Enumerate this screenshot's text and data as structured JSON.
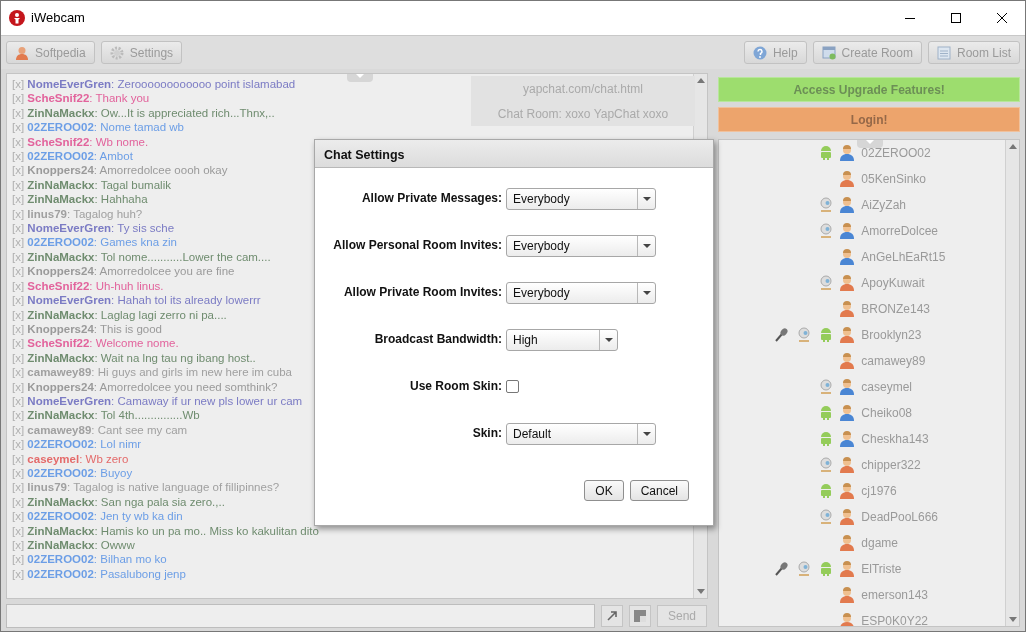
{
  "window": {
    "title": "iWebcam"
  },
  "toolbar": {
    "left": [
      {
        "label": "Softpedia"
      },
      {
        "label": "Settings"
      }
    ],
    "right": [
      {
        "label": "Help"
      },
      {
        "label": "Create Room"
      },
      {
        "label": "Room List"
      }
    ]
  },
  "chat": {
    "messages": [
      {
        "mark": "[x]",
        "name": "NomeEverGren",
        "text": ": Zeroooooooooooo point islamabad",
        "color": "#7b7bc4"
      },
      {
        "mark": "[x]",
        "name": "ScheSnif22",
        "text": ": Thank you",
        "color": "#e2639c"
      },
      {
        "mark": "[x]",
        "name": "ZinNaMackx",
        "text": ": Ow...It is appreciated rich...Thnx,..",
        "color": "#6f8c6f"
      },
      {
        "mark": "[x]",
        "name": "02ZEROO02",
        "text": ": Nome tamad wb",
        "color": "#6c9ee6"
      },
      {
        "mark": "[x]",
        "name": "ScheSnif22",
        "text": ": Wb nome.",
        "color": "#e2639c"
      },
      {
        "mark": "[x]",
        "name": "02ZEROO02",
        "text": ": Ambot",
        "color": "#6c9ee6"
      },
      {
        "mark": "[x]",
        "name": "Knoppers24",
        "text": ": Amorredolcee oooh okay",
        "color": "#9a9a9a"
      },
      {
        "mark": "[x]",
        "name": "ZinNaMackx",
        "text": ": Tagal bumalik",
        "color": "#6f8c6f"
      },
      {
        "mark": "[x]",
        "name": "ZinNaMackx",
        "text": ": Hahhaha",
        "color": "#6f8c6f"
      },
      {
        "mark": "[x]",
        "name": "linus79",
        "text": ": Tagalog huh?",
        "color": "#a0a0a0"
      },
      {
        "mark": "[x]",
        "name": "NomeEverGren",
        "text": ": Ty sis sche",
        "color": "#7b7bc4"
      },
      {
        "mark": "[x]",
        "name": "02ZEROO02",
        "text": ": Games kna zin",
        "color": "#6c9ee6"
      },
      {
        "mark": "[x]",
        "name": "ZinNaMackx",
        "text": ": Tol nome...........Lower the cam....",
        "color": "#6f8c6f"
      },
      {
        "mark": "[x]",
        "name": "Knoppers24",
        "text": ": Amorredolcee you are fine",
        "color": "#9a9a9a"
      },
      {
        "mark": "[x]",
        "name": "ScheSnif22",
        "text": ": Uh-huh linus.",
        "color": "#e2639c"
      },
      {
        "mark": "[x]",
        "name": "NomeEverGren",
        "text": ": Hahah tol its already lowerrr",
        "color": "#7b7bc4"
      },
      {
        "mark": "[x]",
        "name": "ZinNaMackx",
        "text": ": Laglag lagi zerro ni pa....",
        "color": "#6f8c6f"
      },
      {
        "mark": "[x]",
        "name": "Knoppers24",
        "text": ": This is good",
        "color": "#9a9a9a"
      },
      {
        "mark": "[x]",
        "name": "ScheSnif22",
        "text": ": Welcome nome.",
        "color": "#e2639c"
      },
      {
        "mark": "[x]",
        "name": "ZinNaMackx",
        "text": ": Wait na lng tau ng ibang host..",
        "color": "#6f8c6f"
      },
      {
        "mark": "[x]",
        "name": "camawey89",
        "text": ": Hi guys and girls im new here im cuba",
        "color": "#a0a0a0"
      },
      {
        "mark": "[x]",
        "name": "Knoppers24",
        "text": ": Amorredolcee you need somthink?",
        "color": "#9a9a9a"
      },
      {
        "mark": "[x]",
        "name": "NomeEverGren",
        "text": ": Camaway if ur new pls lower ur cam",
        "color": "#7b7bc4"
      },
      {
        "mark": "[x]",
        "name": "ZinNaMackx",
        "text": ": Tol 4th...............Wb",
        "color": "#6f8c6f"
      },
      {
        "mark": "[x]",
        "name": "camawey89",
        "text": ": Cant see my cam",
        "color": "#a0a0a0"
      },
      {
        "mark": "[x]",
        "name": "02ZEROO02",
        "text": ": Lol nimr",
        "color": "#6c9ee6"
      },
      {
        "mark": "[x]",
        "name": "caseymel",
        "text": ": Wb zero",
        "color": "#e46a6a"
      },
      {
        "mark": "[x]",
        "name": "02ZEROO02",
        "text": ": Buyoy",
        "color": "#6c9ee6"
      },
      {
        "mark": "[x]",
        "name": "linus79",
        "text": ": Tagalog is native language of fillipinnes?",
        "color": "#a0a0a0"
      },
      {
        "mark": "[x]",
        "name": "ZinNaMackx",
        "text": ": San nga pala sia zero.,..",
        "color": "#6f8c6f"
      },
      {
        "mark": "[x]",
        "name": "02ZEROO02",
        "text": ": Jen ty wb ka din",
        "color": "#6c9ee6"
      },
      {
        "mark": "[x]",
        "name": "ZinNaMackx",
        "text": ": Hamis ko un pa mo.. Miss ko kakulitan dito",
        "color": "#6f8c6f"
      },
      {
        "mark": "[x]",
        "name": "ZinNaMackx",
        "text": ": Owww",
        "color": "#6f8c6f"
      },
      {
        "mark": "[x]",
        "name": "02ZEROO02",
        "text": ": Bilhan mo ko",
        "color": "#6c9ee6"
      },
      {
        "mark": "[x]",
        "name": "02ZEROO02",
        "text": ": Pasalubong jenp",
        "color": "#6c9ee6"
      }
    ],
    "room_info": [
      "yapchat.com/chat.html",
      "Chat Room: xoxo YapChat xoxo"
    ],
    "send_button": "Send"
  },
  "sidebar": {
    "upgrade_button": "Access Upgrade Features!",
    "login_button": "Login!",
    "users": [
      {
        "name": "02ZEROO02",
        "color": "#4a86d4",
        "mic": false,
        "cam": false,
        "mobile": true
      },
      {
        "name": "05KenSinko",
        "color": "#e27a4e",
        "mic": false,
        "cam": false,
        "mobile": false
      },
      {
        "name": "AiZyZah",
        "color": "#4a86d4",
        "mic": false,
        "cam": true,
        "mobile": false
      },
      {
        "name": "AmorreDolcee",
        "color": "#4a86d4",
        "mic": false,
        "cam": true,
        "mobile": false
      },
      {
        "name": "AnGeLhEaRt15",
        "color": "#4a86d4",
        "mic": false,
        "cam": false,
        "mobile": false
      },
      {
        "name": "ApoyKuwait",
        "color": "#e27a4e",
        "mic": false,
        "cam": true,
        "mobile": false
      },
      {
        "name": "BRONZe143",
        "color": "#e27a4e",
        "mic": false,
        "cam": false,
        "mobile": false
      },
      {
        "name": "Brooklyn23",
        "color": "#e27a4e",
        "mic": true,
        "cam": true,
        "mobile": true
      },
      {
        "name": "camawey89",
        "color": "#e27a4e",
        "mic": false,
        "cam": false,
        "mobile": false
      },
      {
        "name": "caseymel",
        "color": "#4a86d4",
        "mic": false,
        "cam": true,
        "mobile": false
      },
      {
        "name": "Cheiko08",
        "color": "#4a86d4",
        "mic": false,
        "cam": false,
        "mobile": true
      },
      {
        "name": "Cheskha143",
        "color": "#4a86d4",
        "mic": false,
        "cam": false,
        "mobile": true
      },
      {
        "name": "chipper322",
        "color": "#e27a4e",
        "mic": false,
        "cam": true,
        "mobile": false
      },
      {
        "name": "cj1976",
        "color": "#e27a4e",
        "mic": false,
        "cam": false,
        "mobile": true
      },
      {
        "name": "DeadPooL666",
        "color": "#e27a4e",
        "mic": false,
        "cam": true,
        "mobile": false
      },
      {
        "name": "dgame",
        "color": "#e27a4e",
        "mic": false,
        "cam": false,
        "mobile": false
      },
      {
        "name": "ElTriste",
        "color": "#e27a4e",
        "mic": true,
        "cam": true,
        "mobile": true
      },
      {
        "name": "emerson143",
        "color": "#e27a4e",
        "mic": false,
        "cam": false,
        "mobile": false
      },
      {
        "name": "ESP0K0Y22",
        "color": "#e27a4e",
        "mic": false,
        "cam": false,
        "mobile": false
      }
    ]
  },
  "dialog": {
    "title": "Chat Settings",
    "fields": [
      {
        "kind": "select",
        "label": "Allow Private Messages:",
        "value": "Everybody"
      },
      {
        "kind": "select",
        "label": "Allow Personal Room Invites:",
        "value": "Everybody"
      },
      {
        "kind": "select",
        "label": "Allow Private Room Invites:",
        "value": "Everybody"
      },
      {
        "kind": "select",
        "label": "Broadcast Bandwidth:",
        "value": "High"
      },
      {
        "kind": "checkbox",
        "label": "Use Room Skin:",
        "checked": false
      },
      {
        "kind": "select",
        "label": "Skin:",
        "value": "Default"
      }
    ],
    "buttons": [
      "OK",
      "Cancel"
    ]
  }
}
